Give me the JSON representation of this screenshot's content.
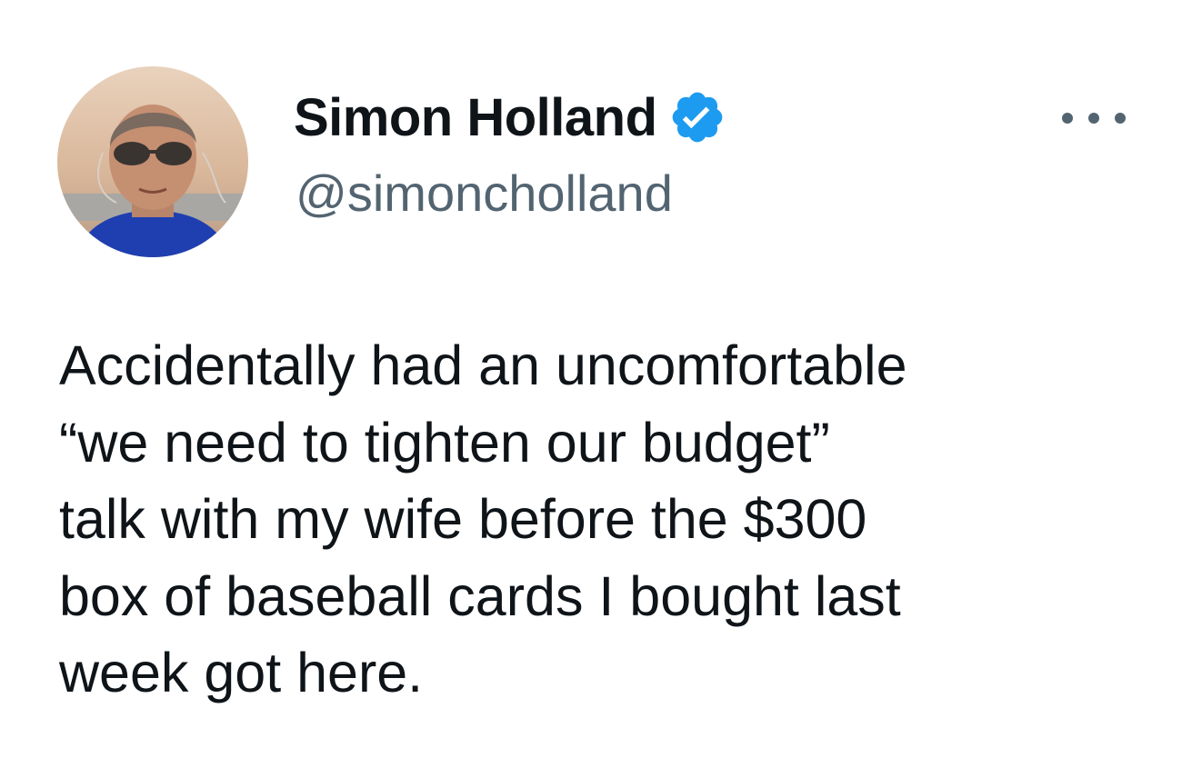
{
  "author": {
    "display_name": "Simon Holland",
    "handle": "@simoncholland",
    "verified": true,
    "avatar": "avatar-photo"
  },
  "tweet": {
    "lines": [
      "Accidentally had an uncomfortable",
      "“we need to tighten our budget”",
      "talk with my wife before the $300",
      "box of baseball cards I bought last",
      "week got here."
    ]
  },
  "icons": {
    "verified": "verified-badge-icon",
    "more": "more-options-icon"
  },
  "colors": {
    "text": "#0f1419",
    "secondary": "#536471",
    "verified_blue": "#1d9bf0"
  }
}
